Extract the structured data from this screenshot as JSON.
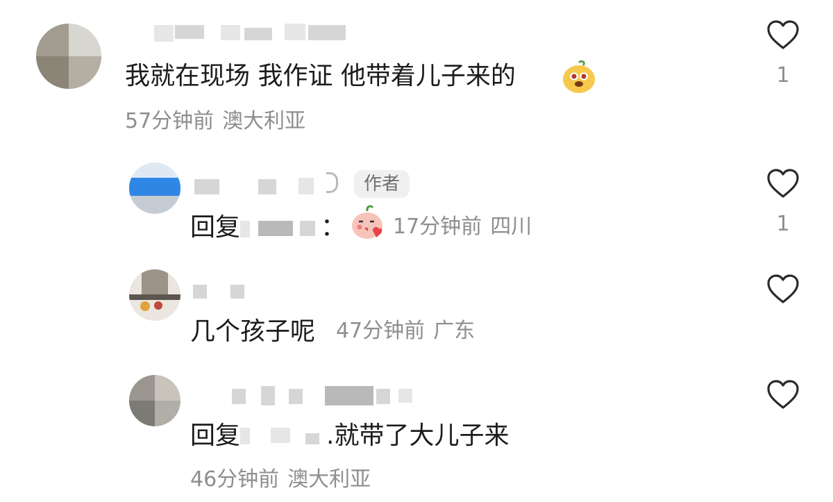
{
  "comments": [
    {
      "text": "我就在现场 我作证 他带着儿子来的",
      "time": "57分钟前",
      "location": "澳大利亚",
      "likes": "1",
      "emoji": "yellow-face-emoji"
    },
    {
      "badge": "作者",
      "reply_prefix": "回复",
      "colon": "：",
      "time": "17分钟前",
      "location": "四川",
      "likes": "1",
      "emoji": "blushing-face-emoji"
    },
    {
      "text": "几个孩子呢",
      "time": "47分钟前",
      "location": "广东",
      "likes": ""
    },
    {
      "reply_prefix": "回复",
      "text": ".就带了大儿子来",
      "time": "46分钟前",
      "location": "澳大利亚",
      "likes": ""
    }
  ],
  "icons": {
    "like": "heart-outline-icon"
  },
  "colors": {
    "text": "#1c1c1c",
    "meta": "#8e8e8e",
    "badge_bg": "#f0f0f0"
  }
}
